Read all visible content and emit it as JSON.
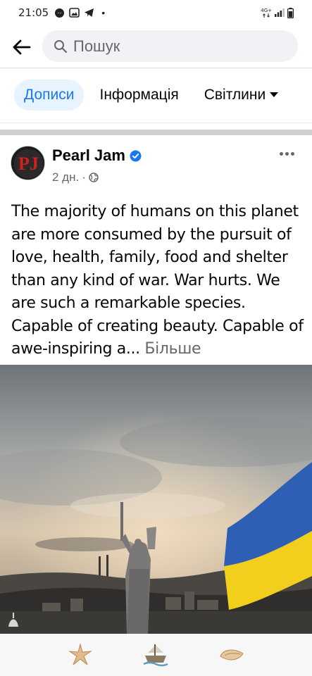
{
  "status": {
    "time": "21:05",
    "network": "4G+"
  },
  "search": {
    "placeholder": "Пошук"
  },
  "tabs": [
    {
      "label": "Дописи",
      "active": true
    },
    {
      "label": "Інформація",
      "active": false
    },
    {
      "label": "Світлини",
      "active": false
    }
  ],
  "post": {
    "page_name": "Pearl Jam",
    "verified": true,
    "time_ago": "2 дн.",
    "audience_icon": "globe-icon",
    "text": "The majority of humans on this planet are more consumed by the pursuit of love, health, family, food and shelter than any kind of war. War hurts. We are such a remarkable species. Capable of creating beauty. Capable of awe-inspiring a...",
    "see_more": "Більше",
    "avatar_initials": "PJ"
  },
  "bottom_nav": [
    {
      "icon": "starfish-icon"
    },
    {
      "icon": "ship-icon"
    },
    {
      "icon": "shell-icon"
    }
  ],
  "colors": {
    "accent": "#1877f2",
    "tab_active_bg": "#e7f3ff",
    "flag_blue": "#2e5fb5",
    "flag_yellow": "#f2cf1c"
  }
}
